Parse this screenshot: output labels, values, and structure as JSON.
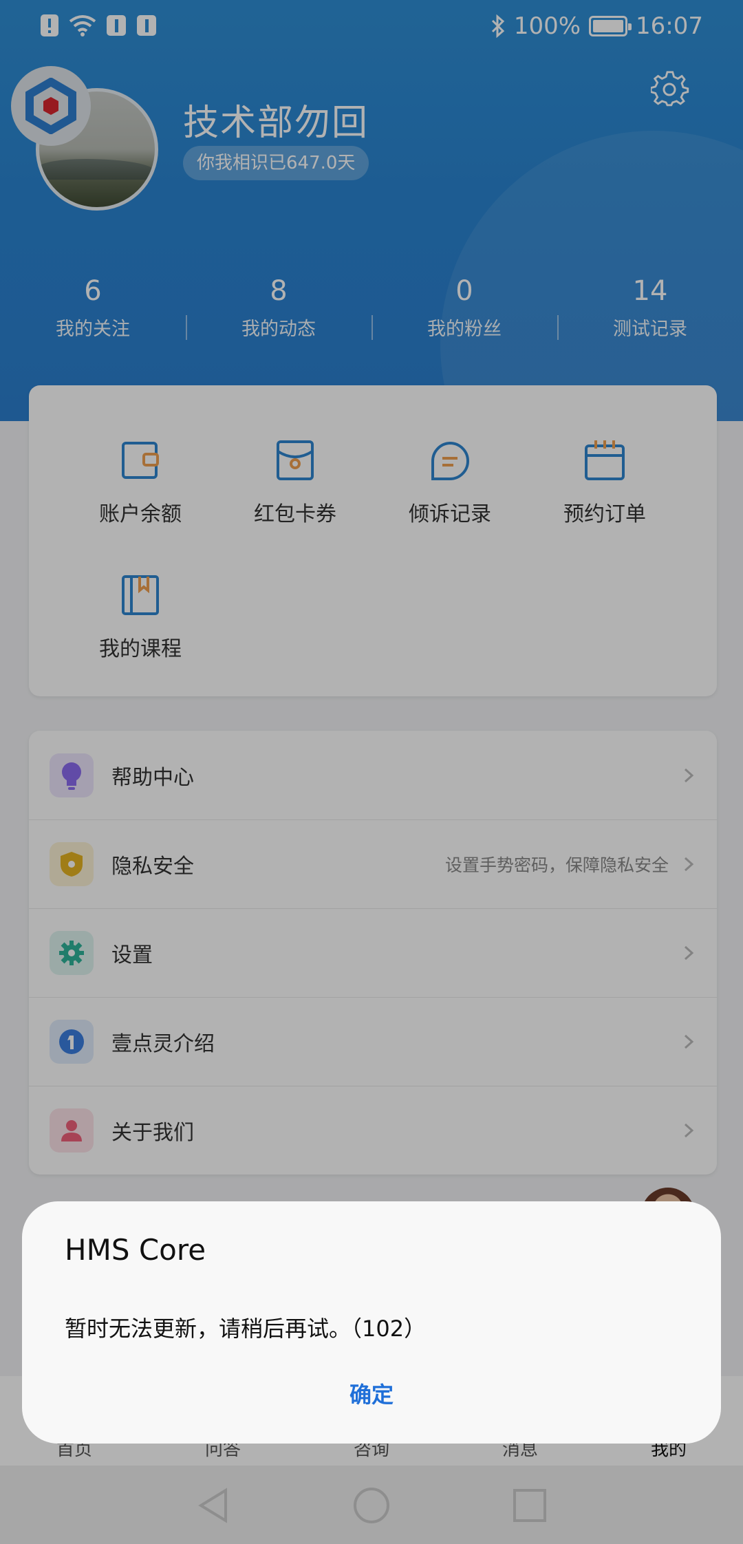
{
  "status_bar": {
    "battery": "100%",
    "time": "16:07"
  },
  "profile": {
    "name": "技术部勿回",
    "days": "你我相识已647.0天"
  },
  "stats": [
    {
      "count": "6",
      "label": "我的关注"
    },
    {
      "count": "8",
      "label": "我的动态"
    },
    {
      "count": "0",
      "label": "我的粉丝"
    },
    {
      "count": "14",
      "label": "测试记录"
    }
  ],
  "grid": [
    {
      "label": "账户余额",
      "icon": "wallet-icon"
    },
    {
      "label": "红包卡券",
      "icon": "red-packet-icon"
    },
    {
      "label": "倾诉记录",
      "icon": "chat-bubble-icon"
    },
    {
      "label": "预约订单",
      "icon": "calendar-icon"
    },
    {
      "label": "我的课程",
      "icon": "book-icon"
    }
  ],
  "menu": [
    {
      "label": "帮助中心",
      "hint": "",
      "icon": "lightbulb-icon",
      "color": "#8c6cf0"
    },
    {
      "label": "隐私安全",
      "hint": "设置手势密码，保障隐私安全",
      "icon": "shield-icon",
      "color": "#e6b422"
    },
    {
      "label": "设置",
      "hint": "",
      "icon": "gear-icon",
      "color": "#2fb39a"
    },
    {
      "label": "壹点灵介绍",
      "hint": "",
      "icon": "info-one-icon",
      "color": "#3b7fe0"
    },
    {
      "label": "关于我们",
      "hint": "",
      "icon": "person-icon",
      "color": "#f0607a"
    }
  ],
  "tabs": [
    "首页",
    "问答",
    "咨询",
    "消息",
    "我的"
  ],
  "dialog": {
    "title": "HMS Core",
    "message": "暂时无法更新，请稍后再试。（102）",
    "button": "确定"
  },
  "colors": {
    "header_blue": "#2a85d2",
    "icon_blue": "#2f86d0",
    "icon_orange": "#f0a050",
    "link_blue": "#1f6fd8"
  }
}
